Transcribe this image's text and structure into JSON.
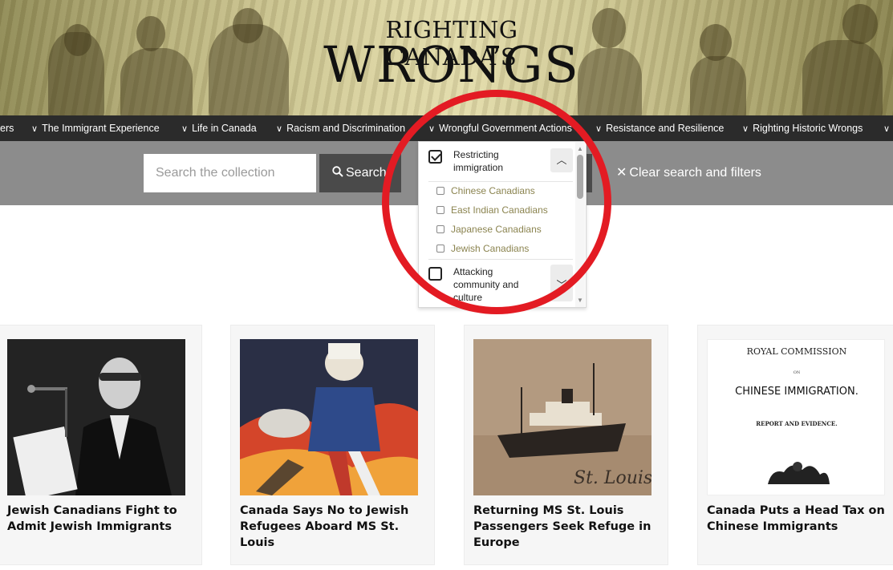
{
  "header": {
    "title_small": "RIGHTING CANADA’S",
    "title_big": "WRONGS"
  },
  "nav": {
    "items": [
      {
        "label": "ers"
      },
      {
        "label": "The Immigrant Experience"
      },
      {
        "label": "Life in Canada"
      },
      {
        "label": "Racism and Discrimination"
      },
      {
        "label": "Wrongful Government Actions"
      },
      {
        "label": "Resistance and Resilience"
      },
      {
        "label": "Righting Historic Wrongs"
      }
    ]
  },
  "search": {
    "placeholder": "Search the collection",
    "button_label": "Search",
    "clear_label": "Clear search and filters"
  },
  "dropdown": {
    "groups": [
      {
        "label": "Restricting immigration",
        "checked": true,
        "expanded": true,
        "items": [
          "Chinese Canadians",
          "East Indian Canadians",
          "Japanese Canadians",
          "Jewish Canadians"
        ]
      },
      {
        "label": "Attacking community and culture",
        "checked": false,
        "expanded": false,
        "items": []
      }
    ]
  },
  "colors": {
    "nav_bg": "#2b2b2b",
    "band_bg": "#8c8c8c",
    "highlight": "#e31b23",
    "subitem": "#8b8450"
  },
  "cards": [
    {
      "title": "Jewish Canadians Fight to Admit Jewish Immigrants"
    },
    {
      "title": "Canada Says No to Jewish Refugees Aboard MS St. Louis"
    },
    {
      "title": "Returning MS St. Louis Passengers Seek Refuge in Europe",
      "image_text": "St. Louis"
    },
    {
      "title": "Canada Puts a Head Tax on Chinese Immigrants",
      "image_text": {
        "line1": "ROYAL COMMISSION",
        "line2": "ON",
        "line3": "CHINESE IMMIGRATION.",
        "line4": "REPORT AND EVIDENCE."
      }
    }
  ]
}
